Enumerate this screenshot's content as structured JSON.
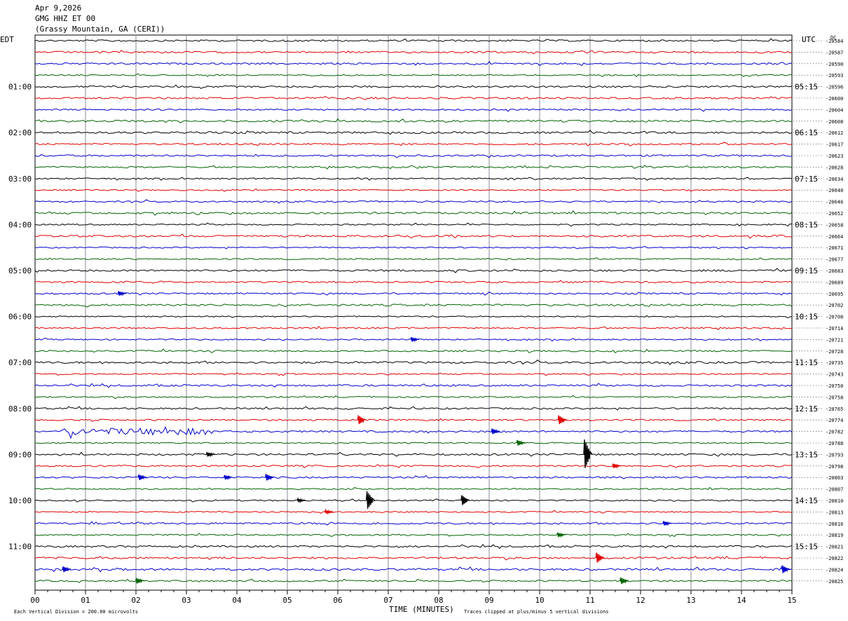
{
  "header": {
    "date": "Apr 9,2026",
    "station": "GMG HHZ ET 00",
    "location": "(Grassy Mountain, GA (CERI))"
  },
  "footer": {
    "scale_note": "Each Vertical Division =  200.00 microvolts",
    "xlabel": "TIME (MINUTES)",
    "clip_note": "Traces clipped at plus/minus 5 vertical divisions"
  },
  "chart_data": {
    "type": "line",
    "title": "",
    "left_axis_label": "EDT",
    "right_axis_label": "UTC",
    "dc_label": "DC",
    "x_ticks": [
      "00",
      "01",
      "02",
      "03",
      "04",
      "05",
      "06",
      "07",
      "08",
      "09",
      "10",
      "11",
      "12",
      "13",
      "14",
      "15"
    ],
    "xlim": [
      0,
      15
    ],
    "grid": true,
    "rows_per_hour": 4,
    "num_rows": 48,
    "trace_colors": [
      "#000000",
      "#e00000",
      "#0000cc",
      "#006400"
    ],
    "edt_labels": [
      "01:00",
      "02:00",
      "03:00",
      "04:00",
      "05:00",
      "06:00",
      "07:00",
      "08:00",
      "09:00",
      "10:00",
      "11:00"
    ],
    "utc_labels": [
      "05:15",
      "06:15",
      "07:15",
      "08:15",
      "09:15",
      "10:15",
      "11:15",
      "12:15",
      "13:15",
      "14:15",
      "15:15"
    ],
    "hour_label_rows": [
      4,
      8,
      12,
      16,
      20,
      24,
      28,
      32,
      36,
      40,
      44
    ],
    "dc_offsets": [
      "-20584",
      "-20587",
      "-20590",
      "-20593",
      "-20596",
      "-20600",
      "-20604",
      "-20608",
      "-20612",
      "-20617",
      "-20623",
      "-20628",
      "-20634",
      "-20640",
      "-20646",
      "-20652",
      "-20658",
      "-20664",
      "-20671",
      "-20677",
      "-20683",
      "-20689",
      "-20695",
      "-20702",
      "-20708",
      "-20714",
      "-20721",
      "-20728",
      "-20735",
      "-20743",
      "-20750",
      "-20758",
      "-20765",
      "-20774",
      "-20782",
      "-20788",
      "-20793",
      "-20798",
      "-20803",
      "-20807",
      "-20810",
      "-20813",
      "-20816",
      "-20819",
      "-20821",
      "-20822",
      "-20824",
      "-20825"
    ],
    "events": [
      {
        "row": 36,
        "minute": 10.93,
        "amplitude": 2.6
      },
      {
        "row": 40,
        "minute": 6.62,
        "amplitude": 1.6
      },
      {
        "row": 40,
        "minute": 8.5,
        "amplitude": 0.9
      },
      {
        "row": 45,
        "minute": 11.17,
        "amplitude": 0.9
      },
      {
        "row": 33,
        "minute": 6.45,
        "amplitude": 0.8
      },
      {
        "row": 33,
        "minute": 10.42,
        "amplitude": 0.8
      },
      {
        "row": 38,
        "minute": 4.62,
        "amplitude": 0.6
      },
      {
        "row": 38,
        "minute": 2.1,
        "amplitude": 0.5
      },
      {
        "row": 38,
        "minute": 3.8,
        "amplitude": 0.4
      },
      {
        "row": 46,
        "minute": 0.6,
        "amplitude": 0.5
      },
      {
        "row": 46,
        "minute": 14.85,
        "amplitude": 0.7
      },
      {
        "row": 47,
        "minute": 11.65,
        "amplitude": 0.6
      },
      {
        "row": 47,
        "minute": 2.05,
        "amplitude": 0.5
      },
      {
        "row": 34,
        "minute": 9.1,
        "amplitude": 0.5
      },
      {
        "row": 35,
        "minute": 9.6,
        "amplitude": 0.5
      },
      {
        "row": 26,
        "minute": 7.5,
        "amplitude": 0.4
      },
      {
        "row": 22,
        "minute": 1.7,
        "amplitude": 0.4
      },
      {
        "row": 42,
        "minute": 12.5,
        "amplitude": 0.4
      },
      {
        "row": 43,
        "minute": 10.4,
        "amplitude": 0.4
      },
      {
        "row": 37,
        "minute": 11.5,
        "amplitude": 0.4
      },
      {
        "row": 36,
        "minute": 3.45,
        "amplitude": 0.4
      },
      {
        "row": 40,
        "minute": 5.25,
        "amplitude": 0.3
      },
      {
        "row": 41,
        "minute": 5.8,
        "amplitude": 0.3
      }
    ],
    "noisy_segments": [
      {
        "row": 34,
        "start": 0.5,
        "end": 3.5,
        "amplitude": 0.35
      }
    ]
  }
}
